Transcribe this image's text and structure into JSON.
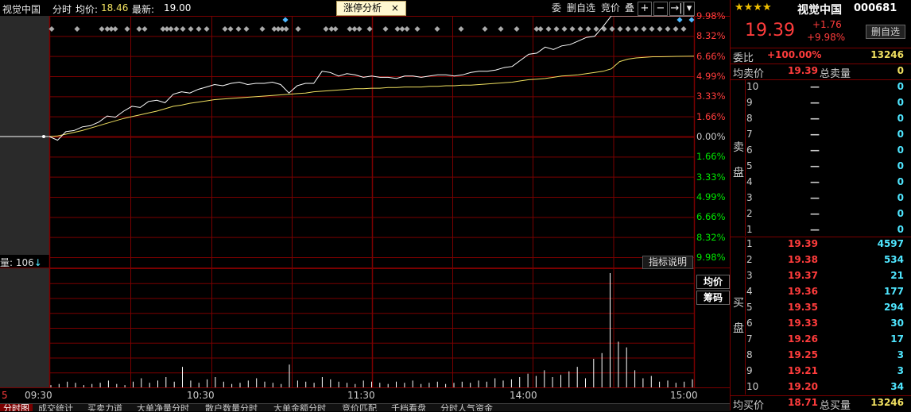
{
  "colors": {
    "up": "#ff3c3c",
    "down": "#00e600",
    "cyan": "#4fe6ff",
    "grid": "#7a0000",
    "price_line": "#ffffff",
    "avg_line": "#f0e060"
  },
  "header": {
    "name": "视觉中国",
    "mode": "分时",
    "avg_label": "均价:",
    "avg_value": "18.46",
    "latest_label": "最新:",
    "latest_value": "19.00",
    "tab": "涨停分析",
    "tab_close": "×",
    "buttons": [
      "委",
      "删自选",
      "竞价",
      "叠"
    ],
    "icons": [
      "plus-icon",
      "minus-icon",
      "jump-end-icon",
      "dropdown-icon"
    ]
  },
  "chart": {
    "pct_labels_up": [
      "9.98%",
      "8.32%",
      "6.66%",
      "4.99%",
      "3.33%",
      "1.66%",
      "0.00%"
    ],
    "pct_labels_down": [
      "1.66%",
      "3.33%",
      "4.99%",
      "6.66%",
      "8.32%",
      "9.98%"
    ],
    "volume_label": "量: 106",
    "indicator_btn": "指标说明",
    "side_buttons": [
      "均价",
      "筹码"
    ],
    "time_labels": [
      "09:30",
      "10:30",
      "11:30",
      "14:00",
      "15:00"
    ],
    "left_edge_label": "5"
  },
  "chart_data": {
    "type": "line",
    "prev_close": 17.63,
    "limit_up": 19.39,
    "x_range": [
      "09:30",
      "15:00"
    ],
    "ylim_pct": [
      -9.98,
      9.98
    ],
    "price_pct": [
      0,
      -0.3,
      0.4,
      0.5,
      0.8,
      0.9,
      1.2,
      1.7,
      1.6,
      2.1,
      2.5,
      2.4,
      2.9,
      3.0,
      2.8,
      3.5,
      3.7,
      3.6,
      3.9,
      4.1,
      4.3,
      4.2,
      4.4,
      4.5,
      4.3,
      4.4,
      4.4,
      4.5,
      4.3,
      3.6,
      4.2,
      4.4,
      4.4,
      5.4,
      5.3,
      5.0,
      5.2,
      5.1,
      4.9,
      5.0,
      4.9,
      4.9,
      4.8,
      5.0,
      5.0,
      4.9,
      5.0,
      5.1,
      5.1,
      5.0,
      5.1,
      5.3,
      5.4,
      5.4,
      5.5,
      5.7,
      5.8,
      6.3,
      6.8,
      6.9,
      7.4,
      7.2,
      7.5,
      7.6,
      7.9,
      8.2,
      8.3,
      9.1,
      9.98,
      9.98,
      9.98,
      9.98,
      9.98,
      9.98,
      9.98,
      9.98,
      9.98,
      9.98,
      9.98
    ],
    "avg_pct": [
      0,
      0.05,
      0.2,
      0.35,
      0.5,
      0.7,
      0.9,
      1.1,
      1.3,
      1.5,
      1.65,
      1.8,
      1.95,
      2.1,
      2.3,
      2.5,
      2.6,
      2.75,
      2.85,
      2.95,
      3.05,
      3.1,
      3.15,
      3.2,
      3.25,
      3.3,
      3.35,
      3.4,
      3.45,
      3.5,
      3.55,
      3.6,
      3.7,
      3.75,
      3.8,
      3.85,
      3.9,
      3.95,
      3.95,
      4.0,
      4.0,
      4.05,
      4.05,
      4.1,
      4.1,
      4.1,
      4.15,
      4.15,
      4.2,
      4.2,
      4.25,
      4.25,
      4.3,
      4.35,
      4.4,
      4.45,
      4.5,
      4.6,
      4.7,
      4.75,
      4.8,
      4.9,
      5.0,
      5.05,
      5.1,
      5.2,
      5.3,
      5.4,
      5.6,
      6.2,
      6.4,
      6.5,
      6.55,
      6.6,
      6.6,
      6.62,
      6.63,
      6.64,
      6.65
    ],
    "volume": [
      2,
      3,
      5,
      4,
      2,
      3,
      4,
      6,
      3,
      2,
      5,
      8,
      4,
      6,
      9,
      5,
      18,
      6,
      4,
      7,
      9,
      5,
      3,
      4,
      6,
      8,
      5,
      4,
      3,
      20,
      6,
      5,
      4,
      9,
      7,
      5,
      4,
      3,
      6,
      5,
      4,
      3,
      5,
      4,
      6,
      3,
      4,
      5,
      3,
      4,
      5,
      4,
      6,
      5,
      8,
      6,
      7,
      9,
      12,
      10,
      15,
      9,
      11,
      14,
      18,
      8,
      25,
      30,
      100,
      40,
      35,
      15,
      8,
      10,
      5,
      6,
      4,
      5,
      7
    ]
  },
  "right_panel": {
    "name": "视觉中国",
    "code": "000681",
    "stars": "★★★★",
    "price": "19.39",
    "change": "+1.76",
    "change_pct": "+9.98%",
    "del_btn": "删自选",
    "weibi_label": "委比",
    "weibi_value": "+100.00%",
    "weibi_amount": "13246",
    "avg_sell_label": "均卖价",
    "avg_sell_value": "19.39",
    "total_sell_label": "总卖量",
    "total_sell_value": "0",
    "sell_side_label": "卖盘",
    "buy_side_label": "买盘",
    "sell_rows": [
      {
        "lvl": "10",
        "price": "—",
        "vol": "0"
      },
      {
        "lvl": "9",
        "price": "—",
        "vol": "0"
      },
      {
        "lvl": "8",
        "price": "—",
        "vol": "0"
      },
      {
        "lvl": "7",
        "price": "—",
        "vol": "0"
      },
      {
        "lvl": "6",
        "price": "—",
        "vol": "0"
      },
      {
        "lvl": "5",
        "price": "—",
        "vol": "0"
      },
      {
        "lvl": "4",
        "price": "—",
        "vol": "0"
      },
      {
        "lvl": "3",
        "price": "—",
        "vol": "0"
      },
      {
        "lvl": "2",
        "price": "—",
        "vol": "0"
      },
      {
        "lvl": "1",
        "price": "—",
        "vol": "0"
      }
    ],
    "buy_rows": [
      {
        "lvl": "1",
        "price": "19.39",
        "vol": "4597"
      },
      {
        "lvl": "2",
        "price": "19.38",
        "vol": "534"
      },
      {
        "lvl": "3",
        "price": "19.37",
        "vol": "21"
      },
      {
        "lvl": "4",
        "price": "19.36",
        "vol": "177"
      },
      {
        "lvl": "5",
        "price": "19.35",
        "vol": "294"
      },
      {
        "lvl": "6",
        "price": "19.33",
        "vol": "30"
      },
      {
        "lvl": "7",
        "price": "19.26",
        "vol": "17"
      },
      {
        "lvl": "8",
        "price": "19.25",
        "vol": "3"
      },
      {
        "lvl": "9",
        "price": "19.21",
        "vol": "3"
      },
      {
        "lvl": "10",
        "price": "19.20",
        "vol": "34"
      }
    ],
    "avg_buy_label": "均买价",
    "avg_buy_value": "18.71",
    "total_buy_label": "总买量",
    "total_buy_value": "13246"
  },
  "bottom_tabs": [
    "分时图",
    "成交统计",
    "买卖力道",
    "大单净量分时",
    "散户数量分时",
    "大单金额分时",
    "竞价匹配",
    "千档看盘",
    "分时人气资金"
  ]
}
